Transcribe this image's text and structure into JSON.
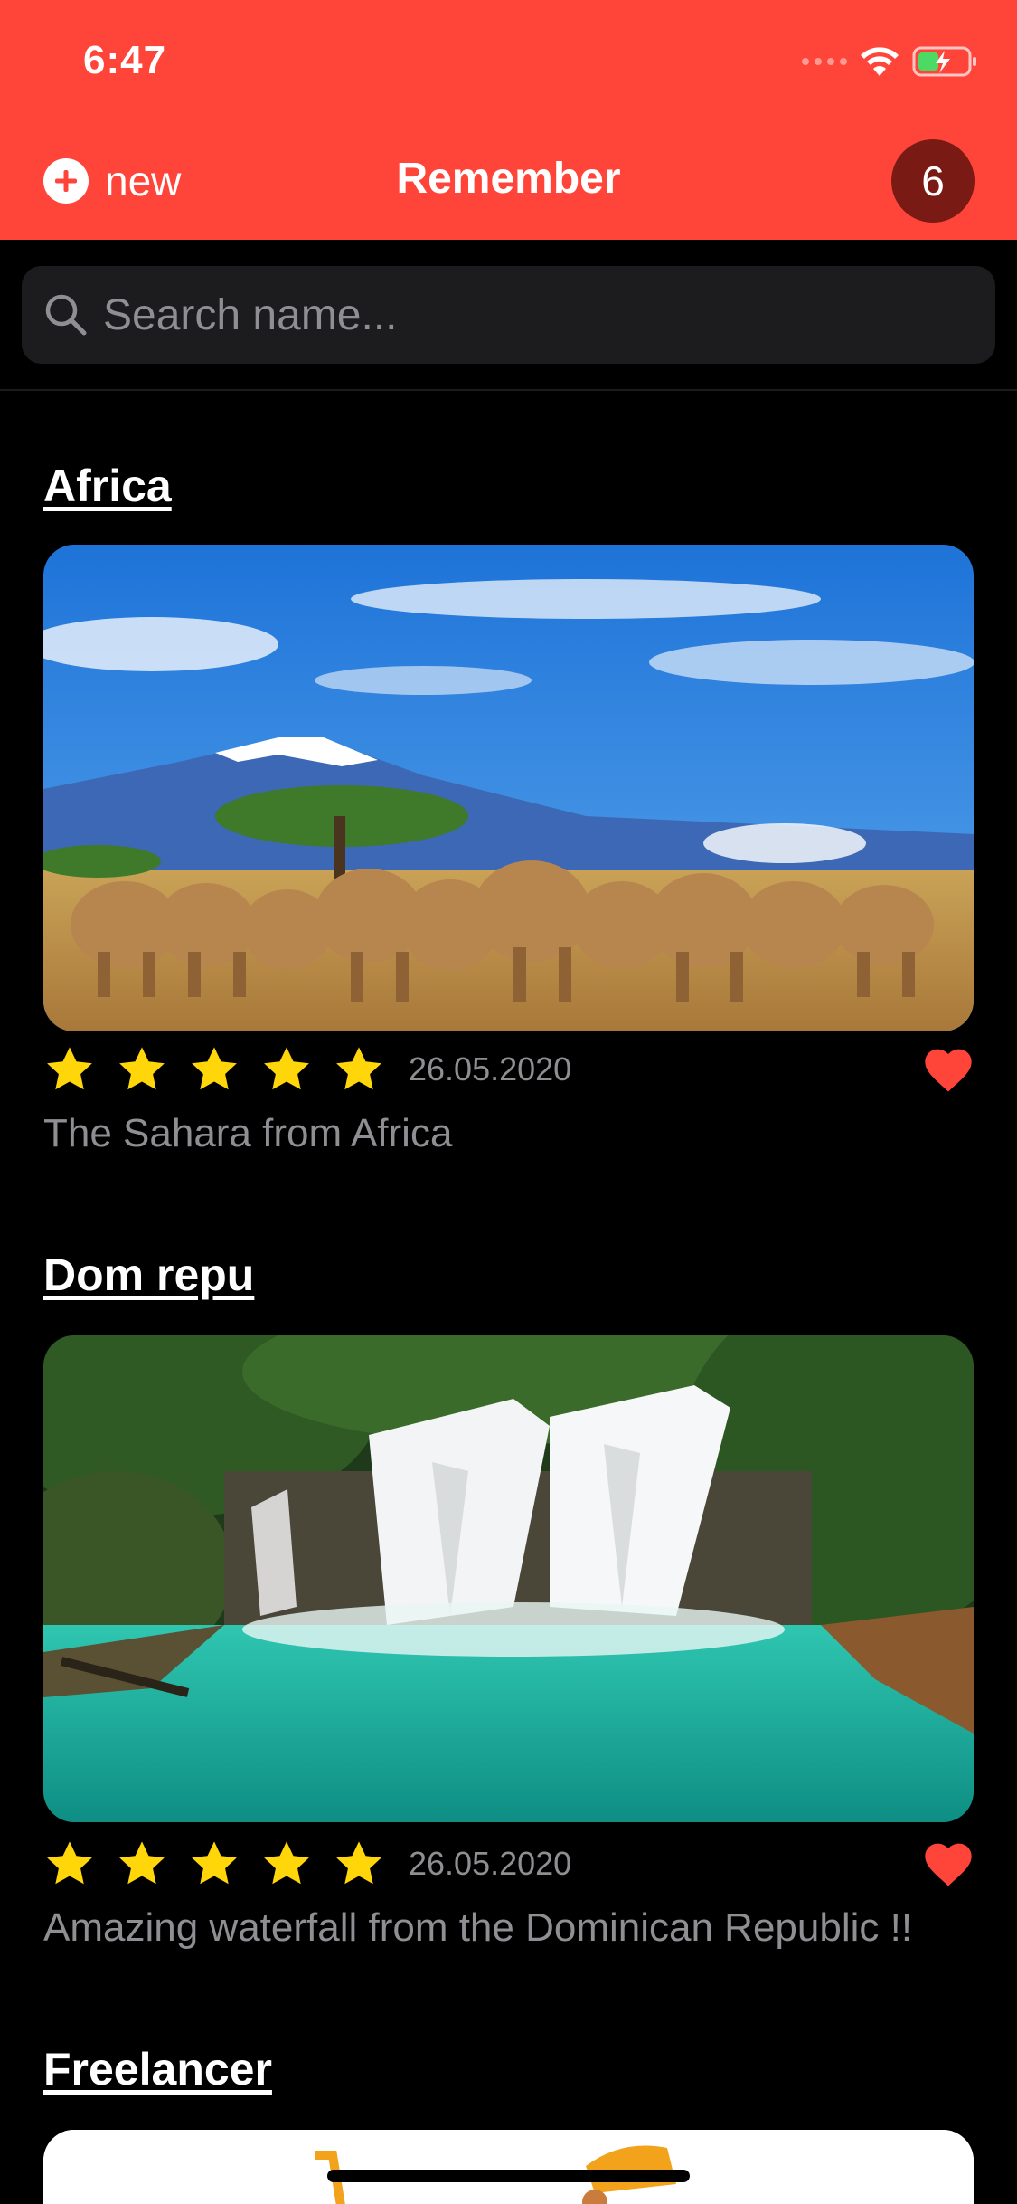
{
  "status_bar": {
    "time": "6:47"
  },
  "header": {
    "new_label": "new",
    "title": "Remember",
    "count": "6"
  },
  "search": {
    "placeholder": "Search name..."
  },
  "entries": [
    {
      "title": "Africa",
      "rating": 5,
      "date": "26.05.2020",
      "favorite": true,
      "description": "The Sahara from Africa"
    },
    {
      "title": "Dom repu",
      "rating": 5,
      "date": "26.05.2020",
      "favorite": true,
      "description": "Amazing waterfall from the Dominican Republic !!"
    },
    {
      "title": "Freelancer"
    }
  ],
  "colors": {
    "accent": "#FF453A",
    "badge": "#7A1A14",
    "star": "#FFD60A",
    "heart": "#FF453A"
  }
}
